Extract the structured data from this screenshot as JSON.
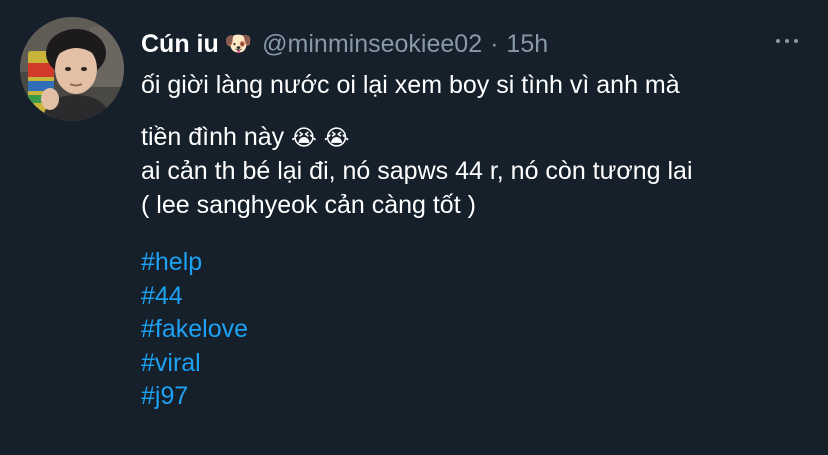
{
  "tweet": {
    "author": {
      "display_name": "Cún iu",
      "name_emoji": "🐶",
      "handle": "@minminseokiee02",
      "separator": "·",
      "timestamp": "15h"
    },
    "avatar_icon": "profile-photo",
    "more_icon": "more-horizontal-icon",
    "body": {
      "line1": "ối giời làng nước oi lại xem boy si tình vì anh mà",
      "line2": "tiền đình này",
      "cry_emoji_1": "😭",
      "cry_emoji_2": "😭",
      "line3": "ai cản th bé lại đi, nó sapws 44 r, nó còn tương lai",
      "line4": "( lee sanghyeok cản càng tốt )"
    },
    "hashtags": [
      "#help",
      "#44",
      "#fakelove",
      "#viral",
      "#j97"
    ]
  },
  "colors": {
    "background": "#15202b",
    "primary_text": "#ffffff",
    "secondary_text": "#8899a6",
    "link": "#1da1f2"
  }
}
